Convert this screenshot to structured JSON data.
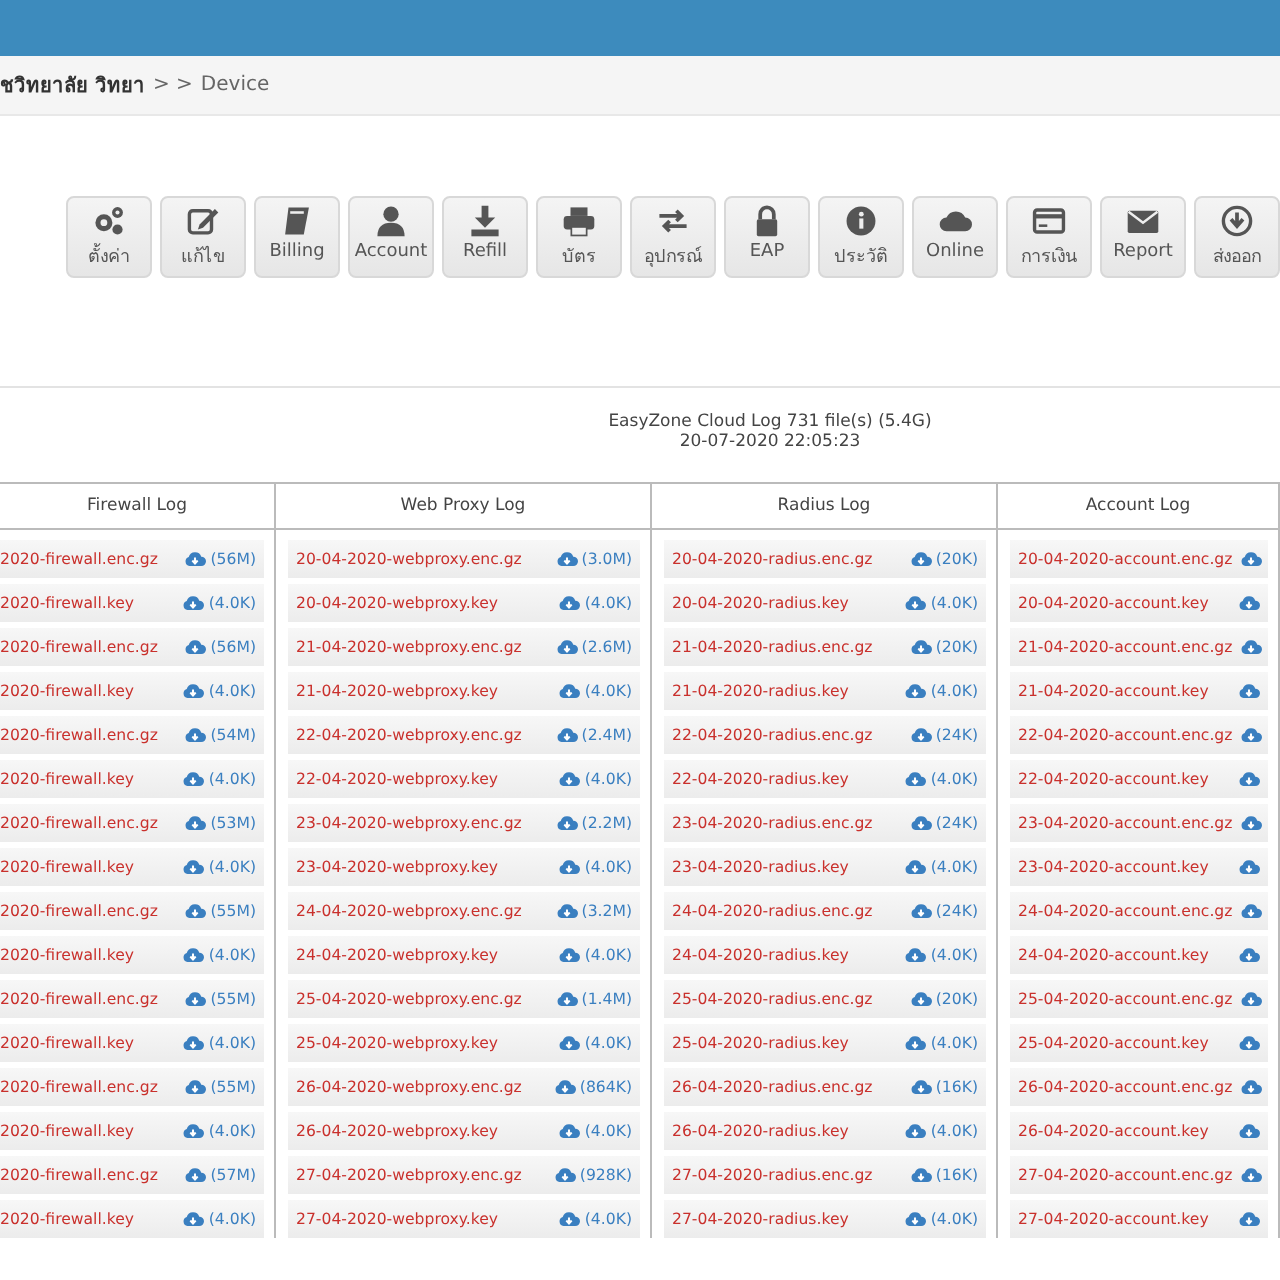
{
  "breadcrumb": {
    "school": "ชวิทยาลัย วิทยา",
    "separator": "> >",
    "current": "Device"
  },
  "toolbar": [
    {
      "label": "ตั้งค่า"
    },
    {
      "label": "แก้ไข"
    },
    {
      "label": "Billing"
    },
    {
      "label": "Account"
    },
    {
      "label": "Refill"
    },
    {
      "label": "บัตร"
    },
    {
      "label": "อุปกรณ์"
    },
    {
      "label": "EAP"
    },
    {
      "label": "ประวัติ"
    },
    {
      "label": "Online"
    },
    {
      "label": "การเงิน"
    },
    {
      "label": "Report"
    },
    {
      "label": "ส่งออก"
    }
  ],
  "log_summary": {
    "title": "EasyZone Cloud Log 731 file(s) (5.4G)",
    "timestamp": "20-07-2020 22:05:23"
  },
  "log_table": {
    "columns": [
      {
        "header": "Firewall Log",
        "files": [
          {
            "name": "2020-firewall.enc.gz",
            "size": "(56M)"
          },
          {
            "name": "2020-firewall.key",
            "size": "(4.0K)"
          },
          {
            "name": "2020-firewall.enc.gz",
            "size": "(56M)"
          },
          {
            "name": "2020-firewall.key",
            "size": "(4.0K)"
          },
          {
            "name": "2020-firewall.enc.gz",
            "size": "(54M)"
          },
          {
            "name": "2020-firewall.key",
            "size": "(4.0K)"
          },
          {
            "name": "2020-firewall.enc.gz",
            "size": "(53M)"
          },
          {
            "name": "2020-firewall.key",
            "size": "(4.0K)"
          },
          {
            "name": "2020-firewall.enc.gz",
            "size": "(55M)"
          },
          {
            "name": "2020-firewall.key",
            "size": "(4.0K)"
          },
          {
            "name": "2020-firewall.enc.gz",
            "size": "(55M)"
          },
          {
            "name": "2020-firewall.key",
            "size": "(4.0K)"
          },
          {
            "name": "2020-firewall.enc.gz",
            "size": "(55M)"
          },
          {
            "name": "2020-firewall.key",
            "size": "(4.0K)"
          },
          {
            "name": "2020-firewall.enc.gz",
            "size": "(57M)"
          },
          {
            "name": "2020-firewall.key",
            "size": "(4.0K)"
          }
        ]
      },
      {
        "header": "Web Proxy Log",
        "files": [
          {
            "name": "20-04-2020-webproxy.enc.gz",
            "size": "(3.0M)"
          },
          {
            "name": "20-04-2020-webproxy.key",
            "size": "(4.0K)"
          },
          {
            "name": "21-04-2020-webproxy.enc.gz",
            "size": "(2.6M)"
          },
          {
            "name": "21-04-2020-webproxy.key",
            "size": "(4.0K)"
          },
          {
            "name": "22-04-2020-webproxy.enc.gz",
            "size": "(2.4M)"
          },
          {
            "name": "22-04-2020-webproxy.key",
            "size": "(4.0K)"
          },
          {
            "name": "23-04-2020-webproxy.enc.gz",
            "size": "(2.2M)"
          },
          {
            "name": "23-04-2020-webproxy.key",
            "size": "(4.0K)"
          },
          {
            "name": "24-04-2020-webproxy.enc.gz",
            "size": "(3.2M)"
          },
          {
            "name": "24-04-2020-webproxy.key",
            "size": "(4.0K)"
          },
          {
            "name": "25-04-2020-webproxy.enc.gz",
            "size": "(1.4M)"
          },
          {
            "name": "25-04-2020-webproxy.key",
            "size": "(4.0K)"
          },
          {
            "name": "26-04-2020-webproxy.enc.gz",
            "size": "(864K)"
          },
          {
            "name": "26-04-2020-webproxy.key",
            "size": "(4.0K)"
          },
          {
            "name": "27-04-2020-webproxy.enc.gz",
            "size": "(928K)"
          },
          {
            "name": "27-04-2020-webproxy.key",
            "size": "(4.0K)"
          }
        ]
      },
      {
        "header": "Radius Log",
        "files": [
          {
            "name": "20-04-2020-radius.enc.gz",
            "size": "(20K)"
          },
          {
            "name": "20-04-2020-radius.key",
            "size": "(4.0K)"
          },
          {
            "name": "21-04-2020-radius.enc.gz",
            "size": "(20K)"
          },
          {
            "name": "21-04-2020-radius.key",
            "size": "(4.0K)"
          },
          {
            "name": "22-04-2020-radius.enc.gz",
            "size": "(24K)"
          },
          {
            "name": "22-04-2020-radius.key",
            "size": "(4.0K)"
          },
          {
            "name": "23-04-2020-radius.enc.gz",
            "size": "(24K)"
          },
          {
            "name": "23-04-2020-radius.key",
            "size": "(4.0K)"
          },
          {
            "name": "24-04-2020-radius.enc.gz",
            "size": "(24K)"
          },
          {
            "name": "24-04-2020-radius.key",
            "size": "(4.0K)"
          },
          {
            "name": "25-04-2020-radius.enc.gz",
            "size": "(20K)"
          },
          {
            "name": "25-04-2020-radius.key",
            "size": "(4.0K)"
          },
          {
            "name": "26-04-2020-radius.enc.gz",
            "size": "(16K)"
          },
          {
            "name": "26-04-2020-radius.key",
            "size": "(4.0K)"
          },
          {
            "name": "27-04-2020-radius.enc.gz",
            "size": "(16K)"
          },
          {
            "name": "27-04-2020-radius.key",
            "size": "(4.0K)"
          }
        ]
      },
      {
        "header": "Account Log",
        "files": [
          {
            "name": "20-04-2020-account.enc.gz"
          },
          {
            "name": "20-04-2020-account.key"
          },
          {
            "name": "21-04-2020-account.enc.gz"
          },
          {
            "name": "21-04-2020-account.key"
          },
          {
            "name": "22-04-2020-account.enc.gz"
          },
          {
            "name": "22-04-2020-account.key"
          },
          {
            "name": "23-04-2020-account.enc.gz"
          },
          {
            "name": "23-04-2020-account.key"
          },
          {
            "name": "24-04-2020-account.enc.gz"
          },
          {
            "name": "24-04-2020-account.key"
          },
          {
            "name": "25-04-2020-account.enc.gz"
          },
          {
            "name": "25-04-2020-account.key"
          },
          {
            "name": "26-04-2020-account.enc.gz"
          },
          {
            "name": "26-04-2020-account.key"
          },
          {
            "name": "27-04-2020-account.enc.gz"
          },
          {
            "name": "27-04-2020-account.key"
          }
        ]
      }
    ]
  }
}
